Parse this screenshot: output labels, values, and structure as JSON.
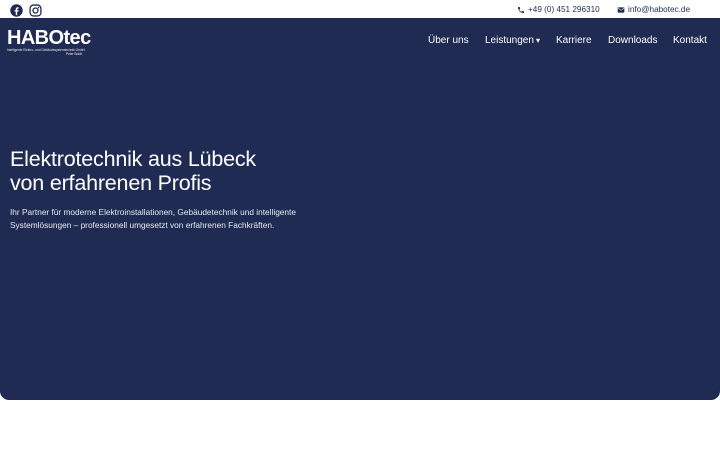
{
  "topbar": {
    "social": [
      {
        "icon": "facebook-icon"
      },
      {
        "icon": "instagram-icon"
      }
    ],
    "phone": {
      "icon": "phone-icon",
      "text": "+49 (0) 451 296310"
    },
    "email": {
      "icon": "envelope-icon",
      "text": "info@habotec.de"
    }
  },
  "logo": {
    "text": "HABOtec",
    "tagline": "Intelligente Elektro- und Gebäudesystemtechnik GmbH",
    "owner": "Peter Boldt"
  },
  "nav": {
    "items": [
      {
        "label": "Über uns"
      },
      {
        "label": "Leistungen",
        "caret": "▾"
      },
      {
        "label": "Karriere"
      },
      {
        "label": "Downloads"
      },
      {
        "label": "Kontakt"
      }
    ]
  },
  "hero": {
    "headline_line1": "Elektrotechnik aus Lübeck",
    "headline_line2": "von erfahrenen Profis",
    "sub_line1": "Ihr Partner für moderne Elektroinstallationen, Gebäudetechnik und intelligente",
    "sub_line2": "Systemlösungen – professionell umgesetzt von erfahrenen Fachkräften."
  },
  "colors": {
    "hero_bg": "#1f2b53",
    "text_dark": "#1f2a52",
    "white": "#ffffff"
  }
}
